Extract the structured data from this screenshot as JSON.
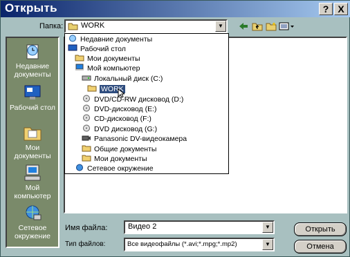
{
  "window": {
    "title": "Открыть",
    "help_button": "?",
    "close_button": "X"
  },
  "lookin": {
    "label": "Папка:",
    "value": "WORK"
  },
  "places": [
    {
      "label": "Недавние документы",
      "icon": "recent-documents-icon"
    },
    {
      "label": "Рабочий стол",
      "icon": "desktop-icon"
    },
    {
      "label": "Мои документы",
      "icon": "my-documents-icon"
    },
    {
      "label": "Мой компьютер",
      "icon": "my-computer-icon"
    },
    {
      "label": "Сетевое окружение",
      "icon": "network-icon"
    }
  ],
  "dropdown_items": [
    {
      "label": "Недавние документы",
      "icon": "recent-documents-icon"
    },
    {
      "label": "Рабочий стол",
      "icon": "desktop-icon"
    },
    {
      "label": "Мои документы",
      "icon": "folder-icon"
    },
    {
      "label": "Мой компьютер",
      "icon": "computer-icon"
    },
    {
      "label": "Локальный диск (C:)",
      "icon": "hard-drive-icon"
    },
    {
      "label": "WORK",
      "icon": "open-folder-icon",
      "selected": true
    },
    {
      "label": "DVD/CD-RW дисковод (D:)",
      "icon": "disc-icon"
    },
    {
      "label": "DVD-дисковод (E:)",
      "icon": "disc-icon"
    },
    {
      "label": "CD-дисковод (F:)",
      "icon": "disc-icon"
    },
    {
      "label": "DVD дисковод (G:)",
      "icon": "disc-icon"
    },
    {
      "label": "Panasonic DV-видеокамера",
      "icon": "camera-icon"
    },
    {
      "label": "Общие документы",
      "icon": "folder-icon"
    },
    {
      "label": "Мои документы",
      "icon": "folder-icon"
    },
    {
      "label": "Сетевое окружение",
      "icon": "network-icon"
    }
  ],
  "filename": {
    "label": "Имя файла:",
    "value": "Видео 2"
  },
  "filetype": {
    "label": "Тип файлов:",
    "value": "Все видеофайлы (*.avi;*.mpg;*.mp2)"
  },
  "buttons": {
    "open": "Открыть",
    "cancel": "Отмена"
  },
  "colors": {
    "title_start": "#0a246a",
    "title_end": "#a6caf0",
    "selection": "#2e4c7e",
    "window": "#a8c0c0",
    "places_bar": "#7a8a6a"
  }
}
